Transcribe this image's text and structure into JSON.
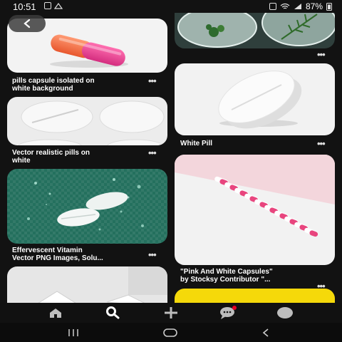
{
  "status_bar": {
    "time": "10:51",
    "battery": "87%"
  },
  "pins": [
    {
      "caption_line1": "pills capsule isolated on",
      "caption_line2": "white background"
    },
    {
      "caption_line1": "Vector realistic pills on",
      "caption_line2": "white"
    },
    {
      "caption_line1": "Effervescent Vitamin",
      "caption_line2": "Vector PNG Images, Solu..."
    },
    {
      "caption_line1": "White Pill",
      "caption_line2": ""
    },
    {
      "caption_line1": "\"Pink And White Capsules\"",
      "caption_line2": "by Stocksy Contributor \"..."
    }
  ],
  "more_glyph": "•••",
  "bottom_nav": [
    "home-icon",
    "search-icon",
    "plus-icon",
    "chat-icon",
    "profile-icon"
  ],
  "system_nav": [
    "recents-icon",
    "home-circle-icon",
    "back-chevron-icon"
  ]
}
